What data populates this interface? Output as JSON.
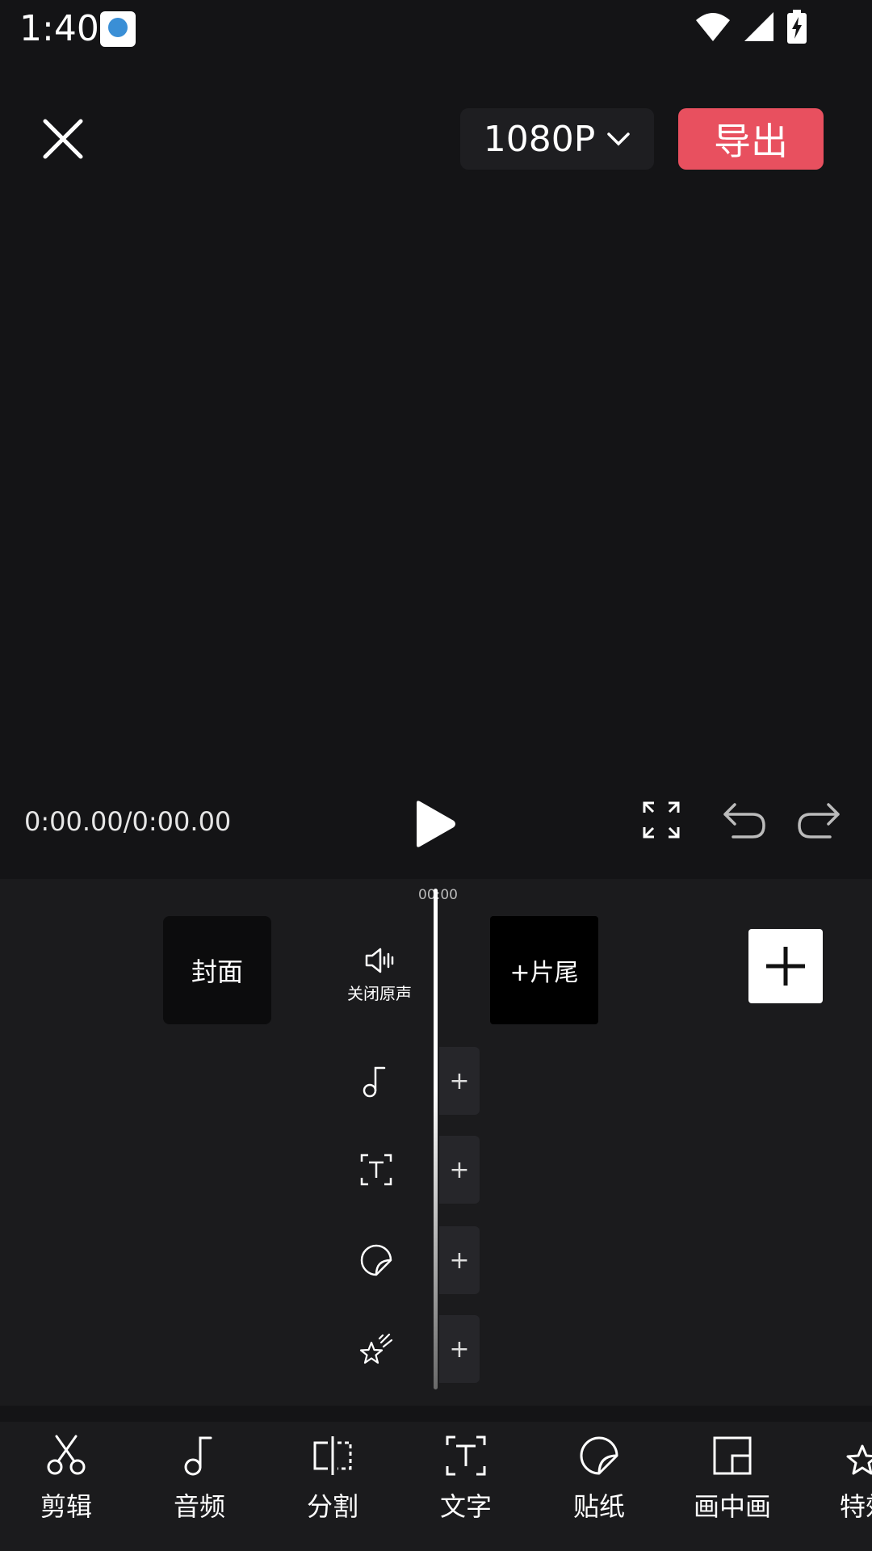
{
  "status": {
    "time": "1:40"
  },
  "toolbar": {
    "resolution": "1080P",
    "export_label": "导出"
  },
  "playback": {
    "time": "0:00.00/0:00.00"
  },
  "timeline": {
    "marker": "00:00",
    "cover_label": "封面",
    "mute_label": "关闭原声",
    "outro_label": "+片尾",
    "track_add": "+"
  },
  "nav": {
    "items": [
      {
        "label": "剪辑",
        "icon": "scissors-icon"
      },
      {
        "label": "音频",
        "icon": "music-note-icon"
      },
      {
        "label": "分割",
        "icon": "split-icon"
      },
      {
        "label": "文字",
        "icon": "text-icon"
      },
      {
        "label": "贴纸",
        "icon": "sticker-icon"
      },
      {
        "label": "画中画",
        "icon": "picture-in-picture-icon"
      },
      {
        "label": "特效",
        "icon": "effects-star-icon"
      }
    ]
  },
  "colors": {
    "accent": "#e8505f",
    "background": "#141416",
    "panel": "#1b1b1d"
  }
}
